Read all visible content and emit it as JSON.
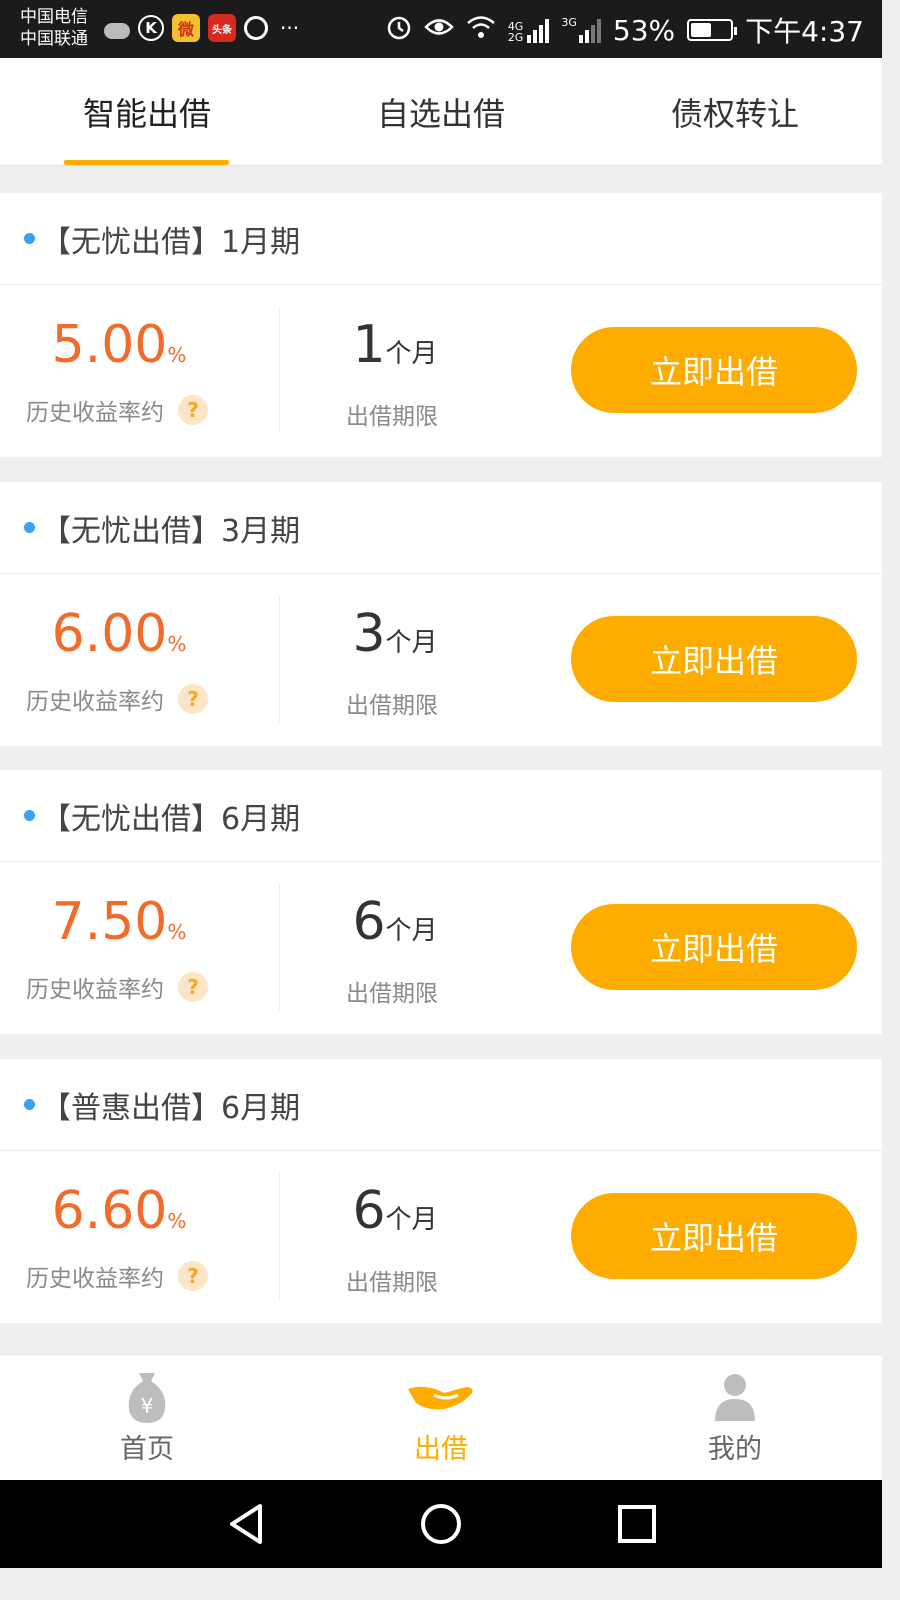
{
  "status_bar": {
    "carrier1": "中国电信",
    "carrier2": "中国联通",
    "app_k": "K",
    "app_weibo": "微",
    "app_toutiao": "头条",
    "more": "···",
    "net1_top": "4G",
    "net1_bottom": "2G",
    "net2": "3G",
    "battery_percent": "53%",
    "battery_level": 0.53,
    "time": "下午4:37"
  },
  "tabs": [
    {
      "label": "智能出借",
      "active": true
    },
    {
      "label": "自选出借",
      "active": false
    },
    {
      "label": "债权转让",
      "active": false
    }
  ],
  "products": [
    {
      "title": "【无忧出借】1月期",
      "rate": "5.00",
      "rate_unit": "%",
      "rate_label": "历史收益率约",
      "term": "1",
      "term_unit": "个月",
      "term_label": "出借期限",
      "button": "立即出借"
    },
    {
      "title": "【无忧出借】3月期",
      "rate": "6.00",
      "rate_unit": "%",
      "rate_label": "历史收益率约",
      "term": "3",
      "term_unit": "个月",
      "term_label": "出借期限",
      "button": "立即出借"
    },
    {
      "title": "【无忧出借】6月期",
      "rate": "7.50",
      "rate_unit": "%",
      "rate_label": "历史收益率约",
      "term": "6",
      "term_unit": "个月",
      "term_label": "出借期限",
      "button": "立即出借"
    },
    {
      "title": "【普惠出借】6月期",
      "rate": "6.60",
      "rate_unit": "%",
      "rate_label": "历史收益率约",
      "term": "6",
      "term_unit": "个月",
      "term_label": "出借期限",
      "button": "立即出借"
    }
  ],
  "help_icon": "?",
  "bottom_nav": [
    {
      "label": "首页",
      "icon": "money-bag-icon",
      "active": false
    },
    {
      "label": "出借",
      "icon": "hand-lend-icon",
      "active": true
    },
    {
      "label": "我的",
      "icon": "person-icon",
      "active": false
    }
  ],
  "colors": {
    "accent": "#ffac00",
    "rate": "#f26b2b",
    "dot": "#3aa0f0"
  }
}
